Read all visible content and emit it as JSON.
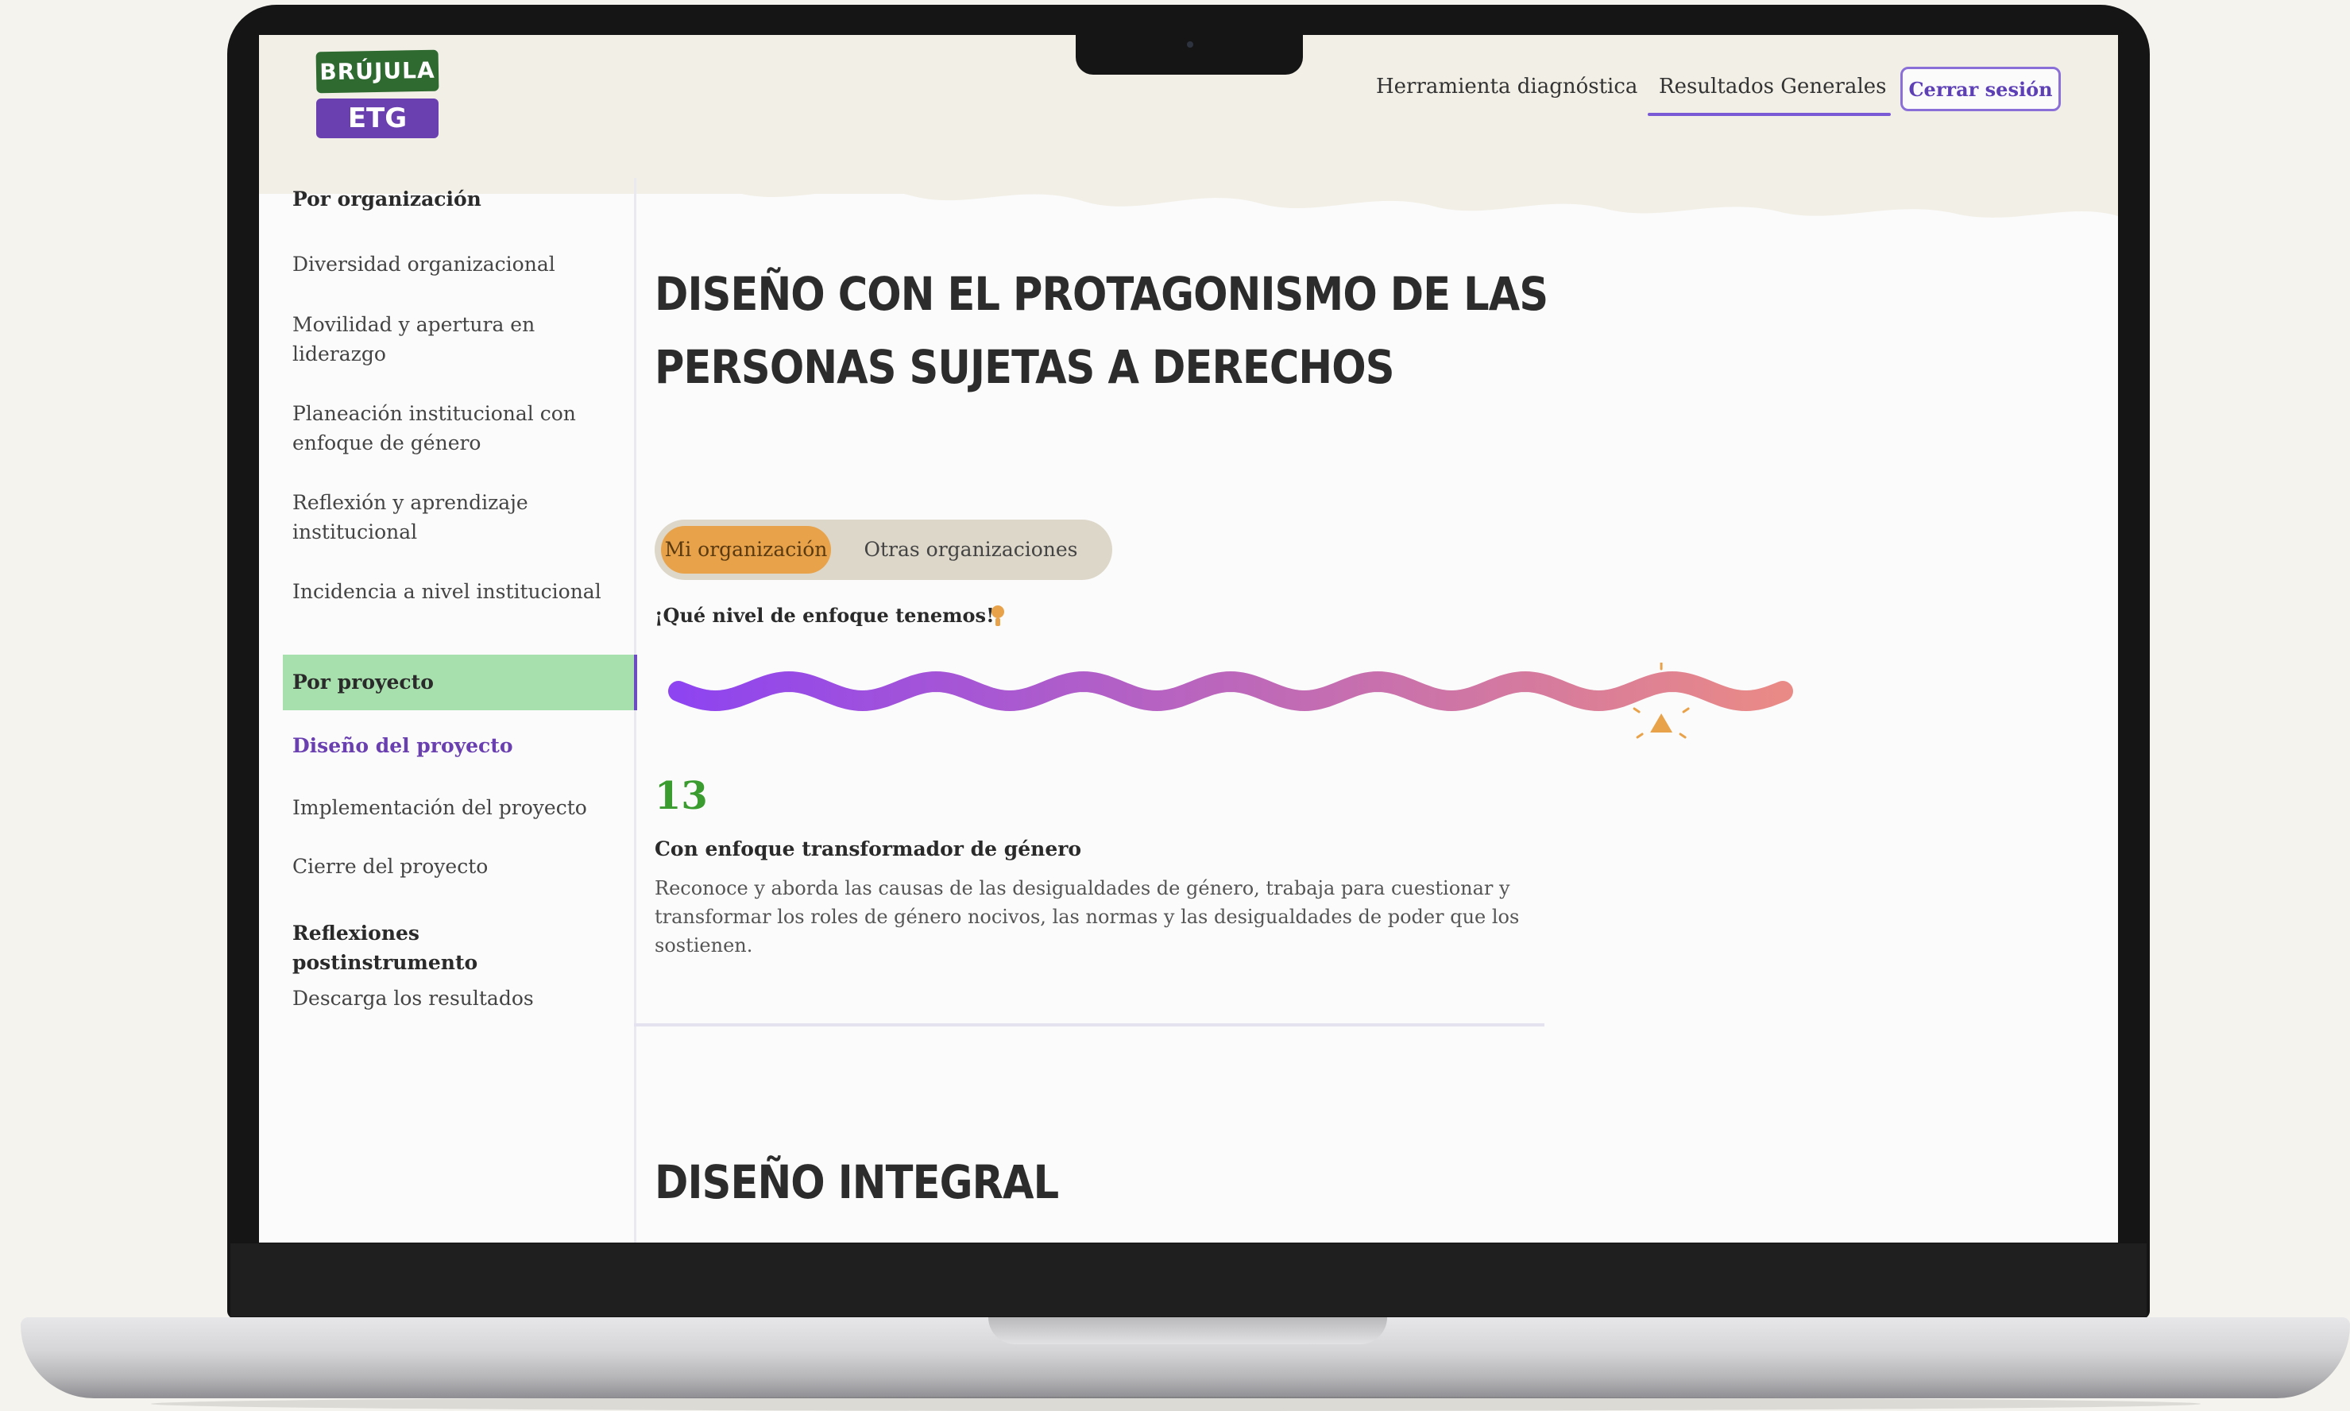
{
  "logo": {
    "top": "BRÚJULA",
    "bottom": "ETG"
  },
  "nav": {
    "items": [
      {
        "label": "Herramienta diagnóstica"
      },
      {
        "label": "Resultados Generales"
      }
    ],
    "logout_label": "Cerrar sesión"
  },
  "sidebar": {
    "by_org_heading": "Por organización",
    "org_items": [
      {
        "label": "Diversidad organizacional"
      },
      {
        "label": "Movilidad y apertura en liderazgo"
      },
      {
        "label": "Planeación institucional con enfoque de género"
      },
      {
        "label": "Reflexión y aprendizaje institucional"
      },
      {
        "label": "Incidencia a nivel institucional"
      }
    ],
    "by_project_heading": "Por proyecto",
    "project_items": [
      {
        "label": "Diseño del proyecto"
      },
      {
        "label": "Implementación del proyecto"
      },
      {
        "label": "Cierre del proyecto"
      }
    ],
    "reflections_heading": "Reflexiones postinstrumento",
    "download_label": "Descarga los resultados"
  },
  "main": {
    "title_line1": "DISEÑO CON EL PROTAGONISMO DE LAS",
    "title_line2": "PERSONAS SUJETAS A DERECHOS",
    "toggle": {
      "active": "Mi organización",
      "inactive": "Otras organizaciones"
    },
    "question": "¡Qué nivel de enfoque tenemos!",
    "scale": {
      "marker_fraction": 0.89,
      "color_start": "#8e44f0",
      "color_end": "#ea8a86",
      "marker_color": "#e8a24a"
    },
    "score": "13",
    "level_title": "Con enfoque transformador de género",
    "level_desc": "Reconoce y aborda las causas de las desigualdades de género, trabaja para cuestionar y transformar los roles de género nocivos, las normas y las desigualdades de poder que los sostienen.",
    "section2_title": "DISEÑO INTEGRAL"
  },
  "colors": {
    "accent_purple": "#6a3fb0",
    "accent_green": "#3a9b2f",
    "sidebar_active_bg": "#a7e0ad",
    "toggle_active": "#e8a24a"
  }
}
